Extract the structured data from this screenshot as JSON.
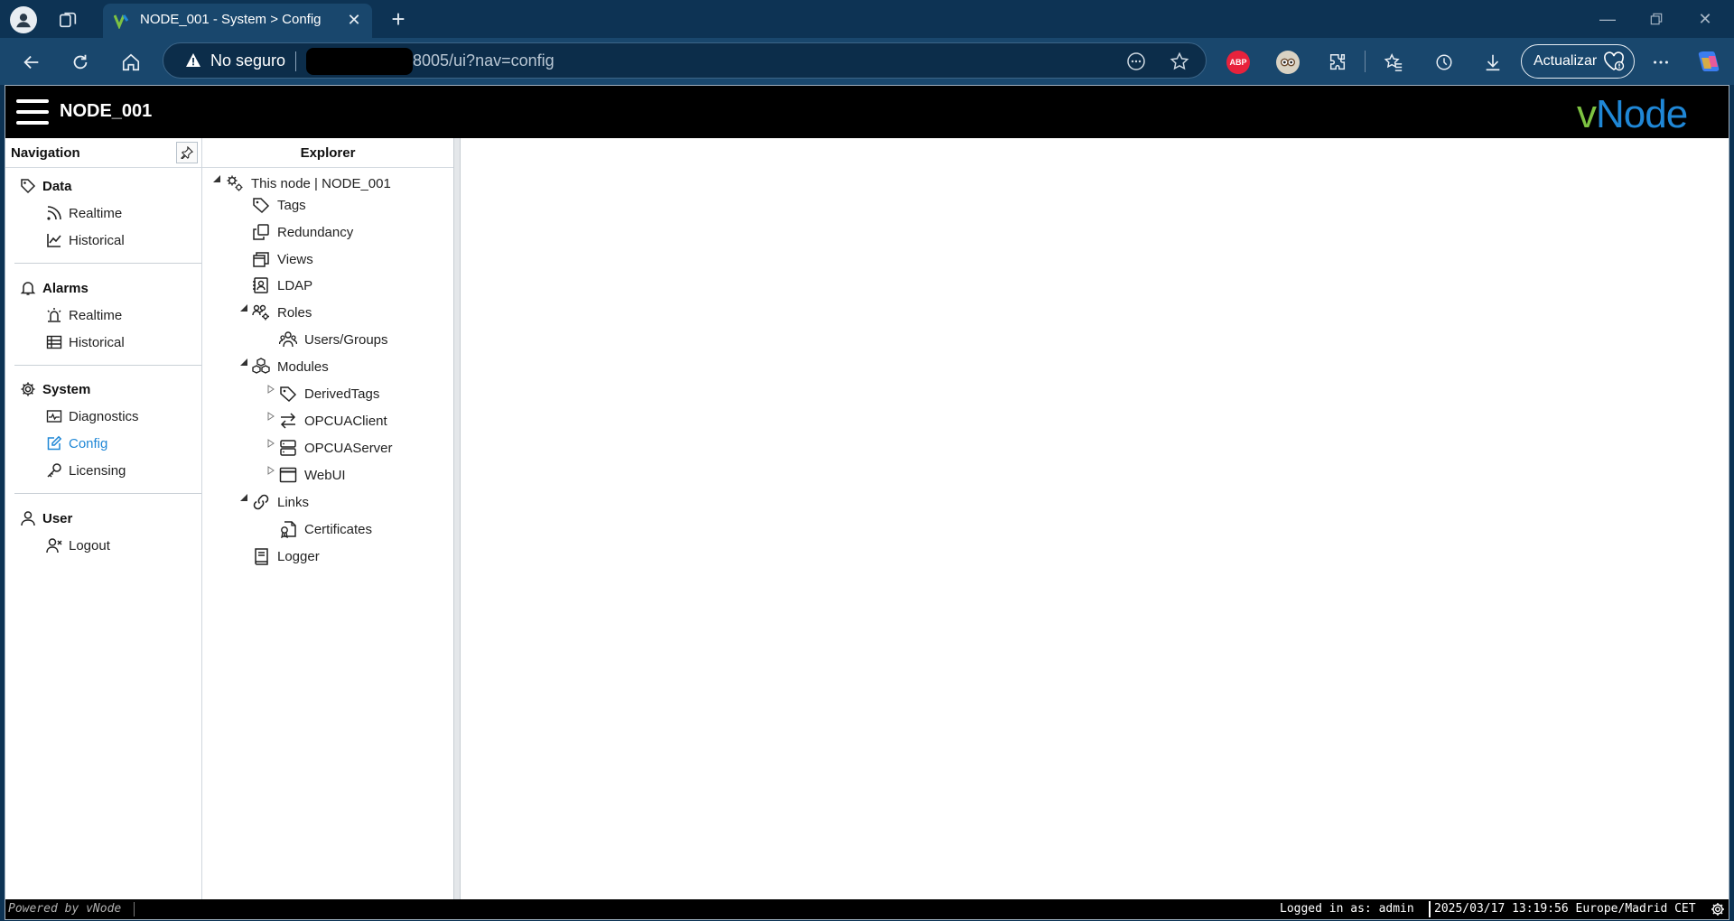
{
  "browser": {
    "tab_title": "NODE_001 - System > Config",
    "security_label": "No seguro",
    "url_visible": "8005/ui?nav=config",
    "update_label": "Actualizar",
    "extension_abp": "ABP"
  },
  "app": {
    "title": "NODE_001",
    "logo_text": "vNode",
    "accent_color": "#1f87d6"
  },
  "navigation": {
    "title": "Navigation",
    "sections": [
      {
        "label": "Data",
        "items": [
          "Realtime",
          "Historical"
        ]
      },
      {
        "label": "Alarms",
        "items": [
          "Realtime",
          "Historical"
        ]
      },
      {
        "label": "System",
        "items": [
          "Diagnostics",
          "Config",
          "Licensing"
        ]
      },
      {
        "label": "User",
        "items": [
          "Logout"
        ]
      }
    ],
    "active_item": "Config"
  },
  "explorer": {
    "title": "Explorer",
    "root": "This node | NODE_001",
    "nodes": [
      "Tags",
      "Redundancy",
      "Views",
      "LDAP",
      "Roles",
      "Users/Groups",
      "Modules",
      "DerivedTags",
      "OPCUAClient",
      "OPCUAServer",
      "WebUI",
      "Links",
      "Certificates",
      "Logger"
    ]
  },
  "status": {
    "powered_by": "Powered by vNode",
    "logged_in": "Logged in as: admin",
    "datetime": "2025/03/17 13:19:56 Europe/Madrid CET"
  }
}
